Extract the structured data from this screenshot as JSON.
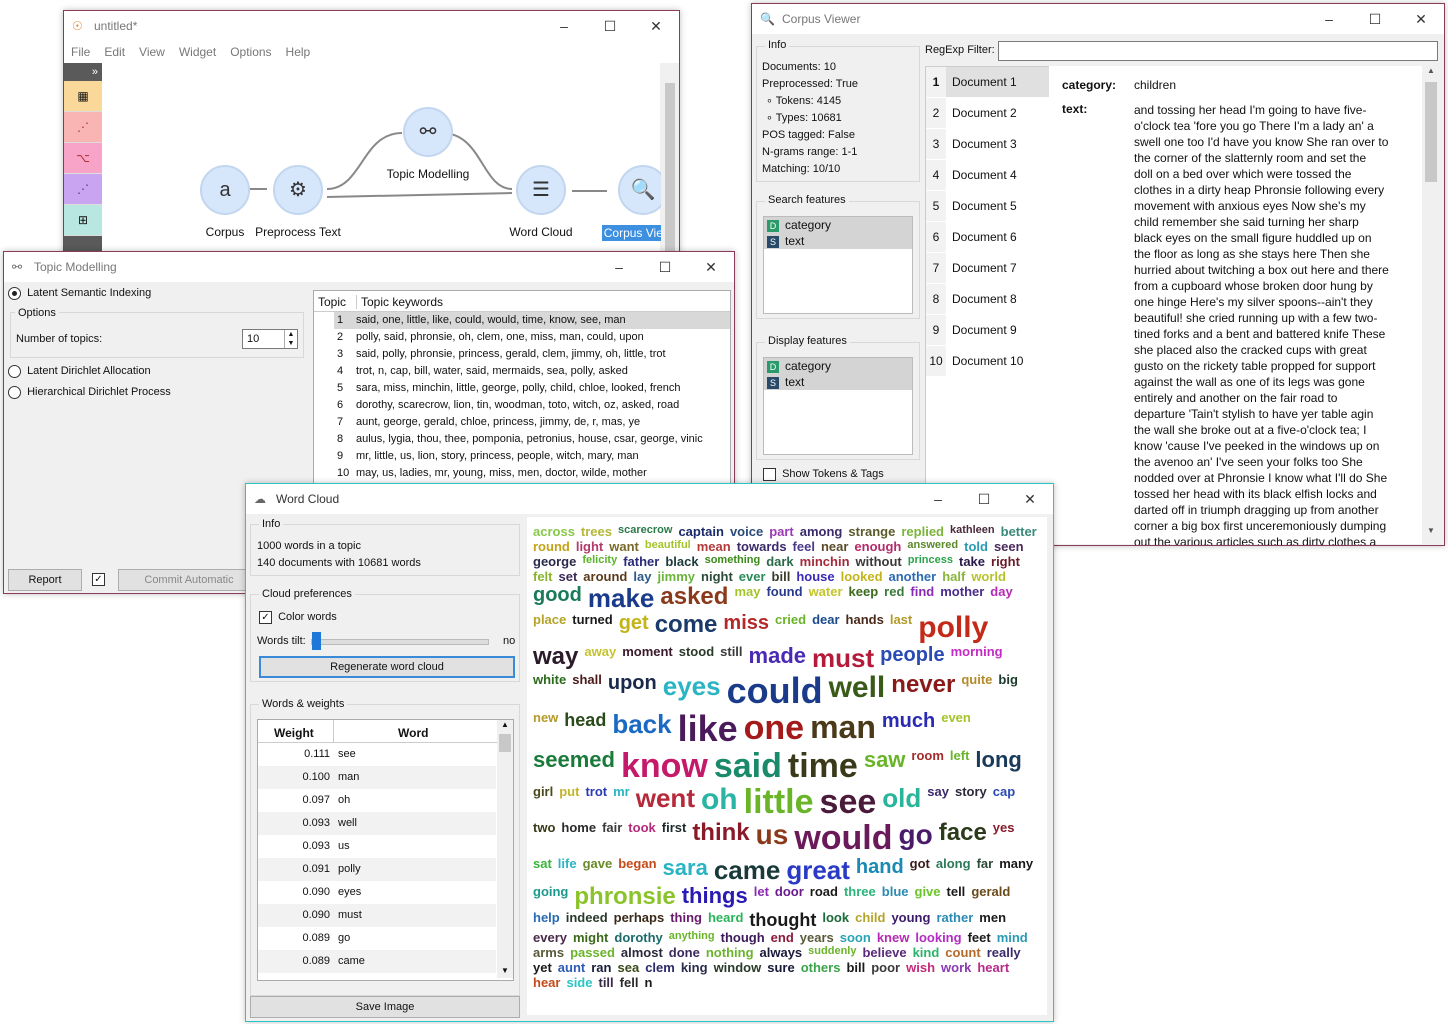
{
  "canvas_window": {
    "title": "untitled*",
    "menu": [
      "File",
      "Edit",
      "View",
      "Widget",
      "Options",
      "Help"
    ],
    "nodes": [
      {
        "label": "Corpus",
        "icon": "a"
      },
      {
        "label": "Preprocess Text",
        "icon": "⚙"
      },
      {
        "label": "Topic Modelling",
        "icon": "⚯"
      },
      {
        "label": "Word Cloud",
        "icon": "☰"
      },
      {
        "label": "Corpus Viewer",
        "icon": "🔍"
      }
    ],
    "toolbox_expand": "»"
  },
  "topic_window": {
    "title": "Topic Modelling",
    "methods": {
      "lsi": "Latent Semantic Indexing",
      "lda": "Latent Dirichlet Allocation",
      "hdp": "Hierarchical Dirichlet Process"
    },
    "options_title": "Options",
    "num_topics_label": "Number of topics:",
    "num_topics_value": "10",
    "table_headers": [
      "Topic",
      "Topic keywords"
    ],
    "topics": [
      {
        "n": "1",
        "k": "said, one, little, like, could, would, time, know, see, man"
      },
      {
        "n": "2",
        "k": "polly, said, phronsie, oh, clem, one, miss, man, could, upon"
      },
      {
        "n": "3",
        "k": "said, polly, phronsie, princess, gerald, clem, jimmy, oh, little, trot"
      },
      {
        "n": "4",
        "k": "trot, n, cap, bill, water, said, mermaids, sea, polly, asked"
      },
      {
        "n": "5",
        "k": "sara, miss, minchin, little, george, polly, child, chloe, looked, french"
      },
      {
        "n": "6",
        "k": "dorothy, scarecrow, lion, tin, woodman, toto, witch, oz, asked, road"
      },
      {
        "n": "7",
        "k": "aunt, george, gerald, chloe, princess, jimmy, de, r, mas, ye"
      },
      {
        "n": "8",
        "k": "aulus, lygia, thou, thee, pomponia, petronius, house, csar, george, vinic"
      },
      {
        "n": "9",
        "k": "mr, little, us, lion, story, princess, people, witch, mary, man"
      },
      {
        "n": "10",
        "k": "may, us, ladies, mr, young, miss, men, doctor, wilde, mother"
      }
    ],
    "report_label": "Report",
    "commit_label": "Commit Automatic"
  },
  "corpus_window": {
    "title": "Corpus Viewer",
    "info_title": "Info",
    "info_lines": [
      "Documents: 10",
      "Preprocessed: True",
      "∘ Tokens: 4145",
      "∘ Types: 10681",
      "POS tagged: False",
      "N-grams range: 1-1",
      "Matching: 10/10"
    ],
    "search_features_title": "Search features",
    "display_features_title": "Display features",
    "features": [
      {
        "badge": "D",
        "name": "category"
      },
      {
        "badge": "S",
        "name": "text"
      }
    ],
    "show_tokens_label": "Show Tokens & Tags",
    "regexp_label": "RegExp Filter:",
    "documents": [
      "Document 1",
      "Document 2",
      "Document 3",
      "Document 4",
      "Document 5",
      "Document 6",
      "Document 7",
      "Document 8",
      "Document 9",
      "Document 10"
    ],
    "category_label": "category:",
    "category_value": "children",
    "text_label": "text:",
    "text_lines": [
      "and tossing her head I'm going to have five-",
      "o'clock tea 'fore you go There I'm a lady an' a",
      "swell one too I'd have you know She ran over to",
      "the corner of the slatternly room and set the",
      "doll on a bed over which were tossed the",
      "clothes in a dirty heap Phronsie following every",
      "movement with anxious eyes Now she's my",
      "child remember she said turning her sharp",
      "black eyes on the small figure huddled up on",
      "the floor as long as she stays here Then she",
      "hurried about twitching a box out here and there",
      "from a cupboard whose broken door hung by",
      "one hinge Here's my silver spoons--ain't they",
      "beautiful! she cried running up with a few two-",
      "tined forks and a bent and battered knife These",
      "she placed also the cracked cups with great",
      "gusto on the rickety table propped for support",
      "against the wall as one of its legs was gone",
      "entirely and another on the fair road to",
      "departure 'Tain't stylish to have yer table agin",
      "the wall she broke out at a five-o'clock tea; I",
      "know 'cause I've peeked in the windows up on",
      "the avenoo an' I've seen your folks too She",
      "nodded over at Phronsie I know what I'll do She",
      "tossed her head with its black elfish locks and",
      "darted off in triumph dragging up from another",
      "corner a big box first unceremoniously dumping",
      "out the various articles such as dirty clothes a"
    ]
  },
  "wordcloud_window": {
    "title": "Word Cloud",
    "info_title": "Info",
    "info_lines": [
      "1000 words in a topic",
      "140 documents with 10681 words"
    ],
    "prefs_title": "Cloud preferences",
    "color_words_label": "Color words",
    "tilt_label": "Words tilt:",
    "tilt_value_label": "no",
    "regenerate_label": "Regenerate word cloud",
    "weights_title": "Words & weights",
    "table_headers": [
      "Weight",
      "Word"
    ],
    "rows": [
      {
        "w": "0.111",
        "word": "see"
      },
      {
        "w": "0.100",
        "word": "man"
      },
      {
        "w": "0.097",
        "word": "oh"
      },
      {
        "w": "0.093",
        "word": "well"
      },
      {
        "w": "0.093",
        "word": "us"
      },
      {
        "w": "0.091",
        "word": "polly"
      },
      {
        "w": "0.090",
        "word": "eyes"
      },
      {
        "w": "0.090",
        "word": "must"
      },
      {
        "w": "0.089",
        "word": "go"
      },
      {
        "w": "0.089",
        "word": "came"
      }
    ],
    "save_label": "Save Image",
    "cloud_words": [
      {
        "t": "across",
        "c": "#88c84a"
      },
      {
        "t": "trees",
        "c": "#b4b83a"
      },
      {
        "t": "scarecrow",
        "c": "#2a7a4a"
      },
      {
        "t": "captain",
        "c": "#1a2a6a"
      },
      {
        "t": "voice",
        "c": "#2a4a7a"
      },
      {
        "t": "part",
        "c": "#9a3ab4"
      },
      {
        "t": "among",
        "c": "#3a2a6a"
      },
      {
        "t": "strange",
        "c": "#5a5a2a"
      },
      {
        "t": "replied",
        "c": "#7ab43a"
      },
      {
        "t": "kathleen",
        "c": "#4a2a3a"
      },
      {
        "t": "better",
        "c": "#3a8a7a"
      },
      {
        "t": "round",
        "c": "#c4a21a"
      },
      {
        "t": "light",
        "c": "#b43a6a"
      },
      {
        "t": "want",
        "c": "#7a6a2a"
      },
      {
        "t": "beautiful",
        "c": "#a4c42a"
      },
      {
        "t": "mean",
        "c": "#b43a3a"
      },
      {
        "t": "towards",
        "c": "#3a2a6a"
      },
      {
        "t": "feel",
        "c": "#4a3a8a"
      },
      {
        "t": "near",
        "c": "#5a4a2a"
      },
      {
        "t": "enough",
        "c": "#b42a6a"
      },
      {
        "t": "answered",
        "c": "#5a8a2a"
      },
      {
        "t": "told",
        "c": "#2a9ab4"
      },
      {
        "t": "seen",
        "c": "#4a2a5a"
      },
      {
        "t": "george",
        "c": "#2a2a4a"
      },
      {
        "t": "felicity",
        "c": "#5ab42a"
      },
      {
        "t": "father",
        "c": "#2a2a7a"
      },
      {
        "t": "black",
        "c": "#1a3a3a"
      },
      {
        "t": "something",
        "c": "#3a8a1a"
      },
      {
        "t": "dark",
        "c": "#2a6a4a"
      },
      {
        "t": "minchin",
        "c": "#a42a3a"
      },
      {
        "t": "without",
        "c": "#3a3a3a"
      },
      {
        "t": "princess",
        "c": "#2aa44a"
      },
      {
        "t": "take",
        "c": "#2a1a4a"
      },
      {
        "t": "right",
        "c": "#6a1a2a"
      },
      {
        "t": "felt",
        "c": "#8ab42a"
      },
      {
        "t": "set",
        "c": "#3a2a5a"
      },
      {
        "t": "around",
        "c": "#5a3a1a"
      },
      {
        "t": "lay",
        "c": "#2a5a8a"
      },
      {
        "t": "jimmy",
        "c": "#6ab43a"
      },
      {
        "t": "night",
        "c": "#2a4a3a"
      },
      {
        "t": "ever",
        "c": "#2a8a5a"
      },
      {
        "t": "bill",
        "c": "#3a3a2a"
      },
      {
        "t": "house",
        "c": "#3a2ab4"
      },
      {
        "t": "looked",
        "c": "#c4b41a"
      },
      {
        "t": "another",
        "c": "#2a6ab4"
      },
      {
        "t": "half",
        "c": "#8ab43a"
      },
      {
        "t": "world",
        "c": "#b4c42a"
      },
      {
        "t": "good",
        "c": "#1a7a5a"
      },
      {
        "t": "make",
        "c": "#1a3a8a"
      },
      {
        "t": "asked",
        "c": "#8a3a1a"
      },
      {
        "t": "may",
        "c": "#a4c42a"
      },
      {
        "t": "found",
        "c": "#2a3a8a"
      },
      {
        "t": "water",
        "c": "#c4c42a"
      },
      {
        "t": "keep",
        "c": "#3a6a1a"
      },
      {
        "t": "red",
        "c": "#3a7a3a"
      },
      {
        "t": "find",
        "c": "#8a2ab4"
      },
      {
        "t": "mother",
        "c": "#4a2a8a"
      },
      {
        "t": "day",
        "c": "#b42ab4"
      },
      {
        "t": "place",
        "c": "#b4a42a"
      },
      {
        "t": "turned",
        "c": "#1a1a1a"
      },
      {
        "t": "get",
        "c": "#c4b41a"
      },
      {
        "t": "come",
        "c": "#1a3a6a"
      },
      {
        "t": "miss",
        "c": "#b42a2a"
      },
      {
        "t": "cried",
        "c": "#6ab42a"
      },
      {
        "t": "dear",
        "c": "#1a4a8a"
      },
      {
        "t": "hands",
        "c": "#4a2a1a"
      },
      {
        "t": "last",
        "c": "#b49a2a"
      },
      {
        "t": "polly",
        "c": "#c42a1a"
      },
      {
        "t": "way",
        "c": "#2a1a2a"
      },
      {
        "t": "away",
        "c": "#c4c42a"
      },
      {
        "t": "moment",
        "c": "#3a1a2a"
      },
      {
        "t": "stood",
        "c": "#2a3a2a"
      },
      {
        "t": "still",
        "c": "#3a3a3a"
      },
      {
        "t": "made",
        "c": "#4a2ab4"
      },
      {
        "t": "must",
        "c": "#b41a3a"
      },
      {
        "t": "people",
        "c": "#2a4ab4"
      },
      {
        "t": "morning",
        "c": "#c42ac4"
      },
      {
        "t": "white",
        "c": "#2a6a1a"
      },
      {
        "t": "shall",
        "c": "#4a1a1a"
      },
      {
        "t": "upon",
        "c": "#1a2a4a"
      },
      {
        "t": "eyes",
        "c": "#2ab4c4"
      },
      {
        "t": "could",
        "c": "#1a3a8a"
      },
      {
        "t": "well",
        "c": "#3a5a1a"
      },
      {
        "t": "never",
        "c": "#8a1a1a"
      },
      {
        "t": "quite",
        "c": "#b48a2a"
      },
      {
        "t": "big",
        "c": "#1a3a2a"
      },
      {
        "t": "new",
        "c": "#b49a2a"
      },
      {
        "t": "head",
        "c": "#2a4a1a"
      },
      {
        "t": "back",
        "c": "#1a6ac4"
      },
      {
        "t": "like",
        "c": "#4a1a5a"
      },
      {
        "t": "one",
        "c": "#a41a1a"
      },
      {
        "t": "man",
        "c": "#4a3a1a"
      },
      {
        "t": "much",
        "c": "#2a2ab4"
      },
      {
        "t": "even",
        "c": "#a4c42a"
      },
      {
        "t": "seemed",
        "c": "#1a7a3a"
      },
      {
        "t": "know",
        "c": "#c41a6a"
      },
      {
        "t": "said",
        "c": "#1a8a6a"
      },
      {
        "t": "time",
        "c": "#3a3a1a"
      },
      {
        "t": "saw",
        "c": "#6ab42a"
      },
      {
        "t": "room",
        "c": "#a42a2a"
      },
      {
        "t": "left",
        "c": "#6ab42a"
      },
      {
        "t": "long",
        "c": "#1a3a5a"
      },
      {
        "t": "girl",
        "c": "#4a4a1a"
      },
      {
        "t": "put",
        "c": "#c4b42a"
      },
      {
        "t": "trot",
        "c": "#2a3ab4"
      },
      {
        "t": "mr",
        "c": "#2ab4c4"
      },
      {
        "t": "went",
        "c": "#b42a3a"
      },
      {
        "t": "oh",
        "c": "#2ab4a4"
      },
      {
        "t": "little",
        "c": "#6ab42a"
      },
      {
        "t": "see",
        "c": "#4a1a3a"
      },
      {
        "t": "old",
        "c": "#2ab49a"
      },
      {
        "t": "say",
        "c": "#3a2a6a"
      },
      {
        "t": "story",
        "c": "#2a2a3a"
      },
      {
        "t": "cap",
        "c": "#2a4ab4"
      },
      {
        "t": "two",
        "c": "#3a3a1a"
      },
      {
        "t": "home",
        "c": "#2a2a2a"
      },
      {
        "t": "fair",
        "c": "#3a3a3a"
      },
      {
        "t": "took",
        "c": "#b42a7a"
      },
      {
        "t": "first",
        "c": "#1a2a2a"
      },
      {
        "t": "think",
        "c": "#8a1a2a"
      },
      {
        "t": "us",
        "c": "#8a3a1a"
      },
      {
        "t": "would",
        "c": "#6a1a5a"
      },
      {
        "t": "go",
        "c": "#4a1a6a"
      },
      {
        "t": "face",
        "c": "#2a3a1a"
      },
      {
        "t": "yes",
        "c": "#8a1a2a"
      },
      {
        "t": "sat",
        "c": "#3ab43a"
      },
      {
        "t": "life",
        "c": "#2ab4c4"
      },
      {
        "t": "gave",
        "c": "#6a8a2a"
      },
      {
        "t": "began",
        "c": "#c44a1a"
      },
      {
        "t": "sara",
        "c": "#2ab4c4"
      },
      {
        "t": "came",
        "c": "#1a3a3a"
      },
      {
        "t": "great",
        "c": "#2a3ac4"
      },
      {
        "t": "hand",
        "c": "#1a8ab4"
      },
      {
        "t": "got",
        "c": "#3a1a1a"
      },
      {
        "t": "along",
        "c": "#2a7a5a"
      },
      {
        "t": "far",
        "c": "#2a4a3a"
      },
      {
        "t": "many",
        "c": "#1a1a1a"
      },
      {
        "t": "going",
        "c": "#1a9a8a"
      },
      {
        "t": "phronsie",
        "c": "#8ac42a"
      },
      {
        "t": "things",
        "c": "#2a1ab4"
      },
      {
        "t": "let",
        "c": "#8a2ab4"
      },
      {
        "t": "door",
        "c": "#6a1a8a"
      },
      {
        "t": "road",
        "c": "#1a1a1a"
      },
      {
        "t": "three",
        "c": "#2ab47a"
      },
      {
        "t": "blue",
        "c": "#2a8ab4"
      },
      {
        "t": "give",
        "c": "#6ac42a"
      },
      {
        "t": "tell",
        "c": "#1a1a1a"
      },
      {
        "t": "gerald",
        "c": "#6a4a1a"
      },
      {
        "t": "help",
        "c": "#2a6ab4"
      },
      {
        "t": "indeed",
        "c": "#2a3a2a"
      },
      {
        "t": "perhaps",
        "c": "#3a2a1a"
      },
      {
        "t": "thing",
        "c": "#6a1a6a"
      },
      {
        "t": "heard",
        "c": "#2ab45a"
      },
      {
        "t": "thought",
        "c": "#1a1a1a"
      },
      {
        "t": "look",
        "c": "#1a6a3a"
      },
      {
        "t": "child",
        "c": "#b4a42a"
      },
      {
        "t": "young",
        "c": "#3a1a6a"
      },
      {
        "t": "rather",
        "c": "#2a8ab4"
      },
      {
        "t": "men",
        "c": "#1a1a1a"
      },
      {
        "t": "every",
        "c": "#4a2a4a"
      },
      {
        "t": "might",
        "c": "#3a6a1a"
      },
      {
        "t": "dorothy",
        "c": "#1a6a6a"
      },
      {
        "t": "anything",
        "c": "#6ab42a"
      },
      {
        "t": "though",
        "c": "#3a1a5a"
      },
      {
        "t": "end",
        "c": "#8a1a3a"
      },
      {
        "t": "years",
        "c": "#5a5a3a"
      },
      {
        "t": "soon",
        "c": "#2aa4b4"
      },
      {
        "t": "knew",
        "c": "#b42ab4"
      },
      {
        "t": "looking",
        "c": "#b42ac4"
      },
      {
        "t": "feet",
        "c": "#1a1a1a"
      },
      {
        "t": "mind",
        "c": "#2a9ab4"
      },
      {
        "t": "arms",
        "c": "#5a5a3a"
      },
      {
        "t": "passed",
        "c": "#6ab42a"
      },
      {
        "t": "almost",
        "c": "#2a2a3a"
      },
      {
        "t": "done",
        "c": "#3a2a5a"
      },
      {
        "t": "nothing",
        "c": "#6ab42a"
      },
      {
        "t": "always",
        "c": "#1a1a3a"
      },
      {
        "t": "suddenly",
        "c": "#6ab42a"
      },
      {
        "t": "believe",
        "c": "#5a2a7a"
      },
      {
        "t": "kind",
        "c": "#2ab46a"
      },
      {
        "t": "count",
        "c": "#b46a2a"
      },
      {
        "t": "really",
        "c": "#3a2a6a"
      },
      {
        "t": "yet",
        "c": "#1a1a1a"
      },
      {
        "t": "aunt",
        "c": "#2a5ab4"
      },
      {
        "t": "ran",
        "c": "#1a1a3a"
      },
      {
        "t": "sea",
        "c": "#3a4a1a"
      },
      {
        "t": "clem",
        "c": "#2a2a6a"
      },
      {
        "t": "king",
        "c": "#2a2a4a"
      },
      {
        "t": "window",
        "c": "#2a3a2a"
      },
      {
        "t": "sure",
        "c": "#1a1a3a"
      },
      {
        "t": "others",
        "c": "#3aa44a"
      },
      {
        "t": "bill",
        "c": "#1a1a1a"
      },
      {
        "t": "poor",
        "c": "#3a3a3a"
      },
      {
        "t": "wish",
        "c": "#c42a7a"
      },
      {
        "t": "work",
        "c": "#8a3ab4"
      },
      {
        "t": "heart",
        "c": "#b42a8a"
      },
      {
        "t": "hear",
        "c": "#c44a1a"
      },
      {
        "t": "side",
        "c": "#2ac4c4"
      },
      {
        "t": "till",
        "c": "#3a2a4a"
      },
      {
        "t": "fell",
        "c": "#2a2a2a"
      },
      {
        "t": "n",
        "c": "#1a1a1a"
      }
    ]
  }
}
